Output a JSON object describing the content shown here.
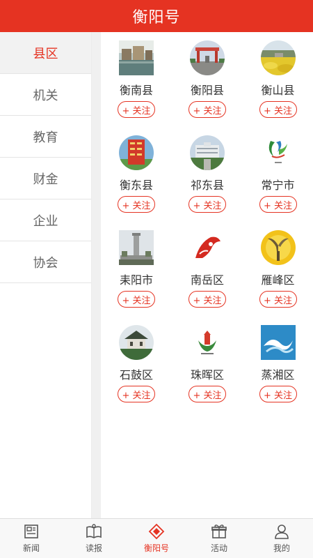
{
  "header": {
    "title": "衡阳号"
  },
  "sidebar": {
    "items": [
      {
        "label": "县区",
        "active": true
      },
      {
        "label": "机关"
      },
      {
        "label": "教育"
      },
      {
        "label": "财金"
      },
      {
        "label": "企业"
      },
      {
        "label": "协会"
      }
    ]
  },
  "accounts": [
    {
      "name": "衡南县",
      "follow": "+ 关注",
      "icon": "town-lake-photo-icon"
    },
    {
      "name": "衡阳县",
      "follow": "+ 关注",
      "icon": "gate-arch-photo-icon"
    },
    {
      "name": "衡山县",
      "follow": "+ 关注",
      "icon": "flower-field-photo-icon"
    },
    {
      "name": "衡东县",
      "follow": "+ 关注",
      "icon": "red-calligraphy-seal-icon"
    },
    {
      "name": "祁东县",
      "follow": "+ 关注",
      "icon": "government-building-photo-icon"
    },
    {
      "name": "常宁市",
      "follow": "+ 关注",
      "icon": "changning-logo-icon"
    },
    {
      "name": "耒阳市",
      "follow": "+ 关注",
      "icon": "monument-tower-photo-icon"
    },
    {
      "name": "南岳区",
      "follow": "+ 关注",
      "icon": "nanyue-red-logo-icon"
    },
    {
      "name": "雁峰区",
      "follow": "+ 关注",
      "icon": "goose-sculpture-photo-icon"
    },
    {
      "name": "石鼓区",
      "follow": "+ 关注",
      "icon": "pavilion-photo-icon"
    },
    {
      "name": "珠晖区",
      "follow": "+ 关注",
      "icon": "zhuhui-logo-icon"
    },
    {
      "name": "蒸湘区",
      "follow": "+ 关注",
      "icon": "zhengxiang-wave-logo-icon"
    }
  ],
  "tabbar": {
    "tabs": [
      {
        "label": "新闻",
        "icon": "newspaper-icon"
      },
      {
        "label": "读报",
        "icon": "open-book-icon"
      },
      {
        "label": "衡阳号",
        "icon": "diamond-logo-icon",
        "active": true
      },
      {
        "label": "活动",
        "icon": "gift-icon"
      },
      {
        "label": "我的",
        "icon": "user-icon"
      }
    ]
  },
  "colors": {
    "brand": "#e53322",
    "active_side_bg": "#f2f2f2"
  }
}
